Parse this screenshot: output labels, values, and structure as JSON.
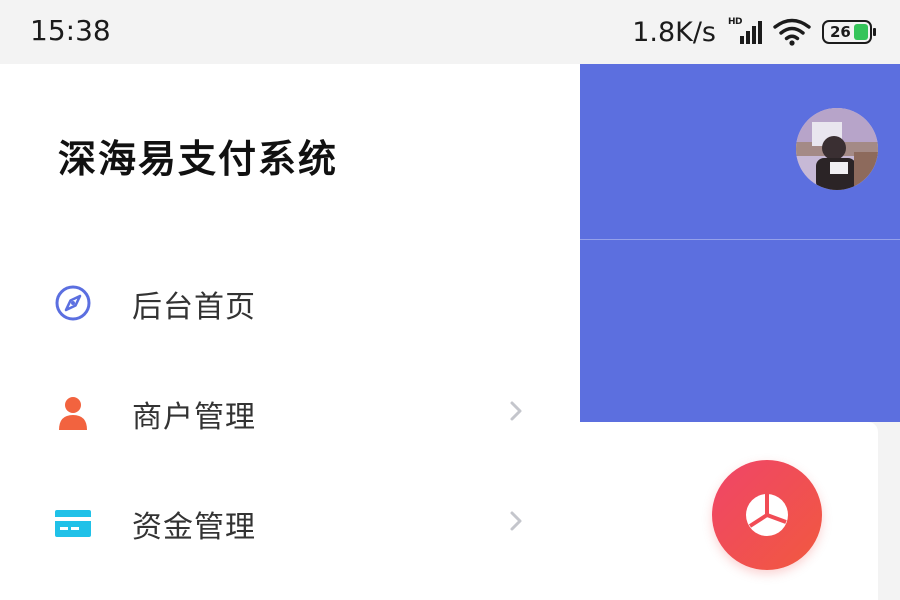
{
  "status_bar": {
    "time": "15:38",
    "net_speed": "1.8K/s",
    "signal_badge": "HD",
    "battery_level": "26",
    "icons": [
      "signal-icon",
      "wifi-icon",
      "battery-icon"
    ]
  },
  "drawer": {
    "title": "深海易支付系统",
    "items": [
      {
        "label": "后台首页",
        "icon": "compass-icon",
        "icon_color": "#5b6fe0",
        "has_chevron": false
      },
      {
        "label": "商户管理",
        "icon": "user-icon",
        "icon_color": "#f2633f",
        "has_chevron": true
      },
      {
        "label": "资金管理",
        "icon": "card-icon",
        "icon_color": "#20c1e8",
        "has_chevron": true
      }
    ]
  },
  "main": {
    "header_color": "#5c6fdf",
    "fab_icon": "pie-chart-icon",
    "fab_gradient": [
      "#f04568",
      "#f1593f"
    ]
  }
}
